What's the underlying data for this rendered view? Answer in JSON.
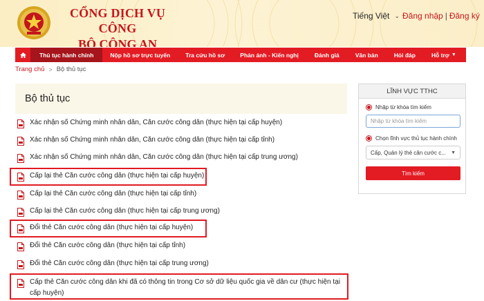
{
  "header": {
    "brand_line1": "CỔNG DỊCH VỤ CÔNG",
    "brand_line2": "BỘ CÔNG AN",
    "language": "Tiếng Việt",
    "login": "Đăng nhập",
    "separator": "|",
    "register": "Đăng ký",
    "brand_color": "#c4161c",
    "emblem_icon": "police-emblem-icon"
  },
  "nav": {
    "items": [
      {
        "label": "Thủ tục hành chính",
        "active": true
      },
      {
        "label": "Nộp hồ sơ trực tuyến"
      },
      {
        "label": "Tra cứu hồ sơ"
      },
      {
        "label": "Phản ánh - Kiến nghị"
      },
      {
        "label": "Đánh giá"
      },
      {
        "label": "Văn bản"
      },
      {
        "label": "Hỏi đáp"
      },
      {
        "label": "Hỗ trợ",
        "dropdown": true
      }
    ],
    "home_icon": "home-icon",
    "bg_color": "#e31b23",
    "active_color": "#a5151b"
  },
  "breadcrumb": {
    "home": "Trang chủ",
    "separator": ">",
    "current": "Bộ thủ tục"
  },
  "main": {
    "title": "Bộ thủ tục",
    "procedures": [
      {
        "text": "Xác nhận số Chứng minh nhân dân, Căn cước công dân (thực hiện tại cấp huyện)"
      },
      {
        "text": "Xác nhận số Chứng minh nhân dân, Căn cước công dân (thực hiện tại cấp tỉnh)"
      },
      {
        "text": "Xác nhận số Chứng minh nhân dân, Căn cước công dân (thực hiện tại cấp trung ương)"
      },
      {
        "text": "Cấp lại thẻ Căn cước công dân (thực hiện tại cấp huyện)",
        "highlighted": true
      },
      {
        "text": "Cấp lại thẻ Căn cước công dân (thực hiện tại cấp tỉnh)"
      },
      {
        "text": "Cấp lại thẻ Căn cước công dân (thực hiện tại cấp trung ương)"
      },
      {
        "text": "Đổi thẻ Căn cước công dân (thực hiện tại cấp huyện)",
        "highlighted": true
      },
      {
        "text": "Đổi thẻ Căn cước công dân (thực hiện tại cấp tỉnh)"
      },
      {
        "text": "Đổi thẻ Căn cước công dân (thực hiện tại cấp trung ương)"
      },
      {
        "text": "Cấp thẻ Căn cước công dân khi đã có thông tin trong Cơ sở dữ liệu quốc gia về dân cư (thực hiện tại cấp huyện)",
        "highlighted": true
      }
    ],
    "doc_icon": "pdf-document-icon",
    "highlight_color": "#e11920"
  },
  "sidebar": {
    "title": "LĨNH VỰC TTHC",
    "radio_keyword": "Nhập từ khóa tìm kiếm",
    "keyword_placeholder": "Nhập từ khóa tìm kiếm",
    "radio_field": "Chọn lĩnh vực thủ tục hành chính",
    "field_selected": "Cấp, Quản lý thẻ căn cước c...",
    "search_button": "Tìm kiếm"
  }
}
